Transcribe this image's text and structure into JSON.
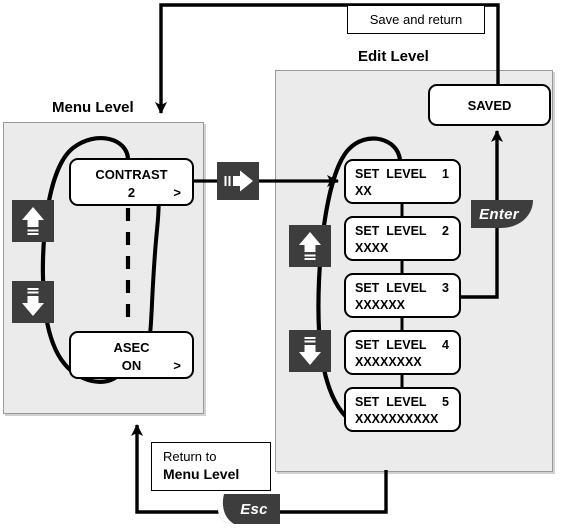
{
  "diagram": {
    "title_menu_level": "Menu Level",
    "title_edit_level": "Edit Level"
  },
  "notes": {
    "save_and_return": "Save and return",
    "return_line1": "Return to",
    "return_line2": "Menu Level"
  },
  "menu_level": {
    "screens": [
      {
        "line1": "CONTRAST",
        "line2": "2",
        "caret": ">"
      },
      {
        "line1": "ASEC",
        "line2": "ON",
        "caret": ">"
      }
    ]
  },
  "edit_level": {
    "saved_label": "SAVED",
    "screens": [
      {
        "label": "SET  LEVEL",
        "number": "1",
        "value": "XX"
      },
      {
        "label": "SET  LEVEL",
        "number": "2",
        "value": "XXXX"
      },
      {
        "label": "SET  LEVEL",
        "number": "3",
        "value": "XXXXXX"
      },
      {
        "label": "SET  LEVEL",
        "number": "4",
        "value": "XXXXXXXX"
      },
      {
        "label": "SET  LEVEL",
        "number": "5",
        "value": "XXXXXXXXXX"
      }
    ]
  },
  "keys": {
    "up": "up-arrow-key",
    "down": "down-arrow-key",
    "right": "right-arrow-key",
    "enter_label": "Enter",
    "esc_label": "Esc"
  },
  "colors": {
    "panel_fill": "#ebebeb",
    "panel_border": "#9a9a9a",
    "key_fill": "#3d3d3d",
    "line": "#000000",
    "screen_fill": "#ffffff"
  }
}
